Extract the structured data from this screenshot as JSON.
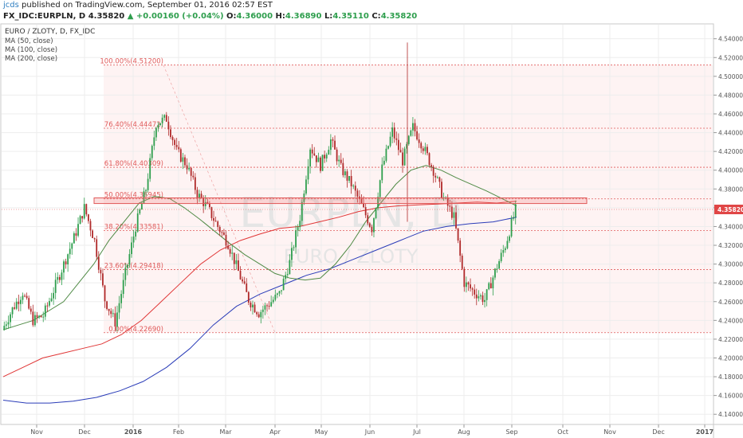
{
  "header": {
    "publisher": "jcds",
    "published_text": "published on TradingView.com, September 01, 2016 02:57 EST",
    "symbol": "FX_IDC:EURPLN, D",
    "last": "4.35820",
    "change": "▲ +0.00160 (+0.04%)",
    "open": "4.36000",
    "high": "4.36890",
    "low": "4.35110",
    "close": "4.35820",
    "label_o": "O:",
    "label_h": "H:",
    "label_l": "L:",
    "label_c": "C:"
  },
  "chart_info": {
    "title": "EURO / ZLOTY, D, FX_IDC",
    "indicators": [
      "MA (50, close)",
      "MA (100, close)",
      "MA (200, close)"
    ],
    "watermark_symbol": "EURPLN, D",
    "watermark_name": "EURO / ZLOTY",
    "price_tag": "4.35820"
  },
  "colors": {
    "up_candle": "#2e9e4d",
    "down_candle": "#b02a2a",
    "ma50": "#4f8a45",
    "ma100": "#e03535",
    "ma200": "#2a3cb8",
    "fib": "#e05a5a",
    "zone_fill": "#fde9e9",
    "price_tag": "#e04646"
  },
  "chart_data": {
    "type": "candlestick",
    "x_tick_labels": [
      "Nov",
      "Dec",
      "2016",
      "Feb",
      "Mar",
      "Apr",
      "May",
      "Jun",
      "Jul",
      "Aug",
      "Sep",
      "Oct",
      "Nov",
      "Dec",
      "2017"
    ],
    "y_tick_labels": [
      "4.54000",
      "4.52000",
      "4.50000",
      "4.48000",
      "4.46000",
      "4.44000",
      "4.42000",
      "4.40000",
      "4.38000",
      "4.36000",
      "4.34000",
      "4.32000",
      "4.30000",
      "4.28000",
      "4.26000",
      "4.24000",
      "4.22000",
      "4.20000",
      "4.18000",
      "4.16000",
      "4.14000"
    ],
    "ylim": [
      4.13,
      4.555
    ],
    "fib_levels": [
      {
        "label": "100.00%(4.51200)",
        "value": 4.512
      },
      {
        "label": "76.40%(4.44472)",
        "value": 4.44472
      },
      {
        "label": "61.80%(4.40309)",
        "value": 4.40309
      },
      {
        "label": "50.00%(4.36945)",
        "value": 4.36945
      },
      {
        "label": "38.20%(4.33581)",
        "value": 4.33581
      },
      {
        "label": "23.60%(4.29418)",
        "value": 4.29418
      },
      {
        "label": "0.00%(4.22690)",
        "value": 4.2269
      }
    ],
    "resistance_zone": [
      4.3645,
      4.3705
    ],
    "last_price": 4.3582,
    "weekly_closes": [
      4.23,
      4.252,
      4.27,
      4.24,
      4.245,
      4.272,
      4.3,
      4.328,
      4.36,
      4.325,
      4.262,
      4.238,
      4.29,
      4.34,
      4.38,
      4.45,
      4.455,
      4.42,
      4.405,
      4.375,
      4.36,
      4.34,
      4.322,
      4.292,
      4.262,
      4.248,
      4.258,
      4.268,
      4.302,
      4.35,
      4.425,
      4.405,
      4.432,
      4.402,
      4.385,
      4.362,
      4.338,
      4.402,
      4.442,
      4.41,
      4.446,
      4.425,
      4.4,
      4.37,
      4.35,
      4.28,
      4.27,
      4.262,
      4.292,
      4.32,
      4.358
    ],
    "ma50": [
      4.23,
      4.235,
      4.24,
      4.25,
      4.26,
      4.28,
      4.3,
      4.325,
      4.345,
      4.365,
      4.372,
      4.37,
      4.36,
      4.348,
      4.335,
      4.322,
      4.31,
      4.3,
      4.29,
      4.285,
      4.283,
      4.285,
      4.3,
      4.32,
      4.345,
      4.365,
      4.385,
      4.4,
      4.405,
      4.4,
      4.392,
      4.385,
      4.378,
      4.37,
      4.362
    ],
    "ma100": [
      4.18,
      4.19,
      4.2,
      4.205,
      4.21,
      4.215,
      4.225,
      4.24,
      4.26,
      4.28,
      4.3,
      4.315,
      4.325,
      4.332,
      4.338,
      4.34,
      4.345,
      4.35,
      4.356,
      4.36,
      4.362,
      4.363,
      4.364,
      4.365,
      4.366,
      4.365,
      4.367
    ],
    "ma200": [
      4.155,
      4.152,
      4.152,
      4.154,
      4.158,
      4.165,
      4.175,
      4.19,
      4.21,
      4.235,
      4.255,
      4.268,
      4.278,
      4.288,
      4.295,
      4.305,
      4.315,
      4.325,
      4.335,
      4.34,
      4.343,
      4.345,
      4.35
    ]
  }
}
